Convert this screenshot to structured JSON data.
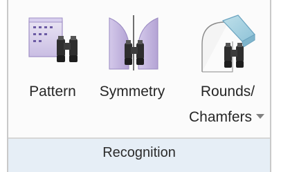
{
  "ribbon": {
    "group_label": "Recognition",
    "buttons": [
      {
        "label": "Pattern",
        "icon": "pattern-recognition-icon"
      },
      {
        "label": "Symmetry",
        "icon": "symmetry-recognition-icon"
      },
      {
        "label_line1": "Rounds/",
        "label_line2": "Chamfers",
        "icon": "rounds-chamfers-recognition-icon",
        "has_dropdown": true
      }
    ]
  },
  "colors": {
    "group_label_bg": "#e6eef6",
    "border": "#c9c9c9",
    "purple_accent": "#b7a6d6",
    "teal_accent": "#a8d2e0"
  }
}
